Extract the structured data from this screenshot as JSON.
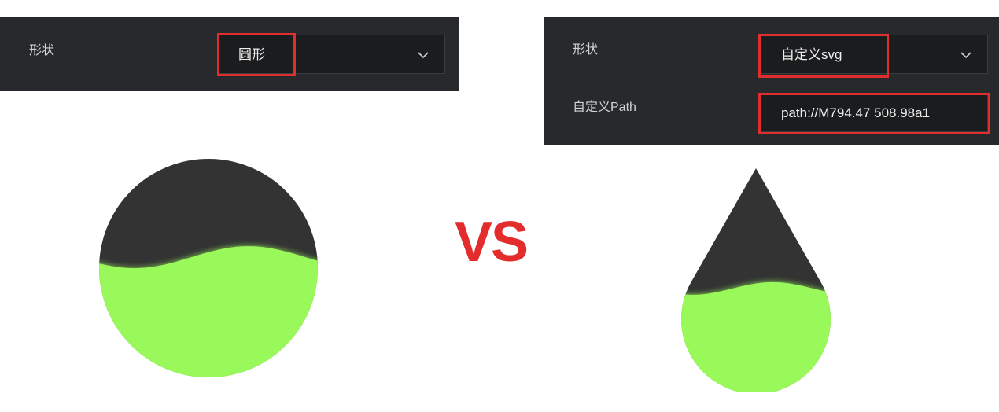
{
  "left_panel": {
    "shape_label": "形状",
    "shape_value": "圆形"
  },
  "right_panel": {
    "shape_label": "形状",
    "shape_value": "自定义svg",
    "path_label": "自定义Path",
    "path_value": "path://M794.47 508.98a1"
  },
  "comparison_label": "VS",
  "colors": {
    "panel_bg": "#27292c",
    "highlight": "#e02d2d",
    "liquid_fill": "#9af95a",
    "shape_empty": "#333333",
    "vs_text": "#e32d2d"
  },
  "icons": {
    "dropdown": "chevron-down-icon"
  },
  "liquid_fill_left": {
    "shape": "circle",
    "level": 0.55
  },
  "liquid_fill_right": {
    "shape": "drop",
    "level": 0.45
  }
}
